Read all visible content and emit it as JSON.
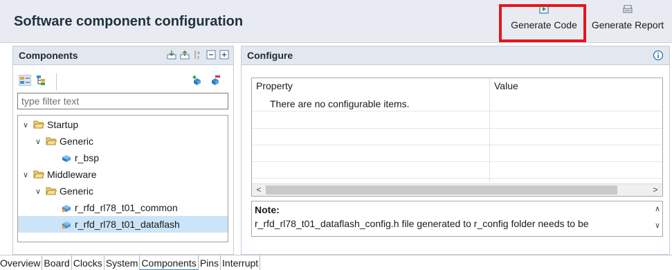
{
  "header": {
    "title": "Software component configuration",
    "generate_code": "Generate Code",
    "generate_report": "Generate Report"
  },
  "components_panel": {
    "title": "Components",
    "filter_placeholder": "type filter text",
    "tree": [
      {
        "label": "Startup",
        "level": 0,
        "type": "folder",
        "expanded": true
      },
      {
        "label": "Generic",
        "level": 1,
        "type": "folder",
        "expanded": true
      },
      {
        "label": "r_bsp",
        "level": 2,
        "type": "component"
      },
      {
        "label": "Middleware",
        "level": 0,
        "type": "folder",
        "expanded": true
      },
      {
        "label": "Generic",
        "level": 1,
        "type": "folder",
        "expanded": true
      },
      {
        "label": "r_rfd_rl78_t01_common",
        "level": 2,
        "type": "component"
      },
      {
        "label": "r_rfd_rl78_t01_dataflash",
        "level": 2,
        "type": "component",
        "selected": true
      }
    ]
  },
  "configure_panel": {
    "title": "Configure",
    "col_property": "Property",
    "col_value": "Value",
    "empty_message": "There are no configurable items.",
    "note_title": "Note:",
    "note_text": "r_rfd_rl78_t01_dataflash_config.h file generated to r_config folder needs to be"
  },
  "tabs": [
    {
      "label": "Overview"
    },
    {
      "label": "Board"
    },
    {
      "label": "Clocks"
    },
    {
      "label": "System"
    },
    {
      "label": "Components",
      "active": true
    },
    {
      "label": "Pins"
    },
    {
      "label": "Interrupt"
    }
  ],
  "colors": {
    "highlight": "#e8141b",
    "selection": "#cce4f7",
    "folder": "#e0b24a",
    "component": "#3a8fd8"
  }
}
